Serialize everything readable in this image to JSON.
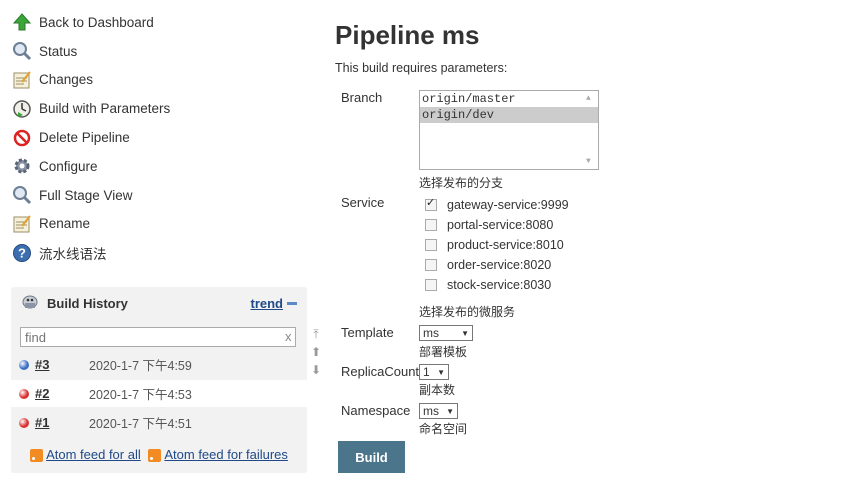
{
  "side_menu": [
    {
      "label": "Back to Dashboard",
      "icon": "up-arrow-icon"
    },
    {
      "label": "Status",
      "icon": "magnifier-icon"
    },
    {
      "label": "Changes",
      "icon": "notepad-icon"
    },
    {
      "label": "Build with Parameters",
      "icon": "clock-icon"
    },
    {
      "label": "Delete Pipeline",
      "icon": "no-entry-icon"
    },
    {
      "label": "Configure",
      "icon": "gear-icon"
    },
    {
      "label": "Full Stage View",
      "icon": "magnifier-icon"
    },
    {
      "label": "Rename",
      "icon": "notepad-icon"
    },
    {
      "label": "流水线语法",
      "icon": "help-icon"
    }
  ],
  "build_history": {
    "title": "Build History",
    "trend_label": "trend",
    "search_placeholder": "find",
    "search_clear": "x",
    "builds": [
      {
        "number": "#3",
        "date": "2020-1-7 下午4:59",
        "status_color": "#3a6fc4"
      },
      {
        "number": "#2",
        "date": "2020-1-7 下午4:53",
        "status_color": "#d93030"
      },
      {
        "number": "#1",
        "date": "2020-1-7 下午4:51",
        "status_color": "#d93030"
      }
    ],
    "feed_all": "Atom feed for all",
    "feed_failures": "Atom feed for failures"
  },
  "main": {
    "title": "Pipeline ms",
    "subtitle": "This build requires parameters:",
    "branch": {
      "label": "Branch",
      "options": [
        "origin/master",
        "origin/dev"
      ],
      "selected": "origin/dev",
      "description": "选择发布的分支"
    },
    "service": {
      "label": "Service",
      "options": [
        {
          "name": "gateway-service:9999",
          "checked": true
        },
        {
          "name": "portal-service:8080",
          "checked": false
        },
        {
          "name": "product-service:8010",
          "checked": false
        },
        {
          "name": "order-service:8020",
          "checked": false
        },
        {
          "name": "stock-service:8030",
          "checked": false
        }
      ],
      "description": "选择发布的微服务"
    },
    "template": {
      "label": "Template",
      "value": "ms",
      "description": "部署模板"
    },
    "replica": {
      "label": "ReplicaCount",
      "value": "1",
      "description": "副本数"
    },
    "namespace": {
      "label": "Namespace",
      "value": "ms",
      "description": "命名空间"
    },
    "build_button": "Build"
  },
  "colors": {
    "build_button_bg": "#4b758b",
    "link": "#204a87",
    "panel_bg": "#f2f2f2"
  }
}
